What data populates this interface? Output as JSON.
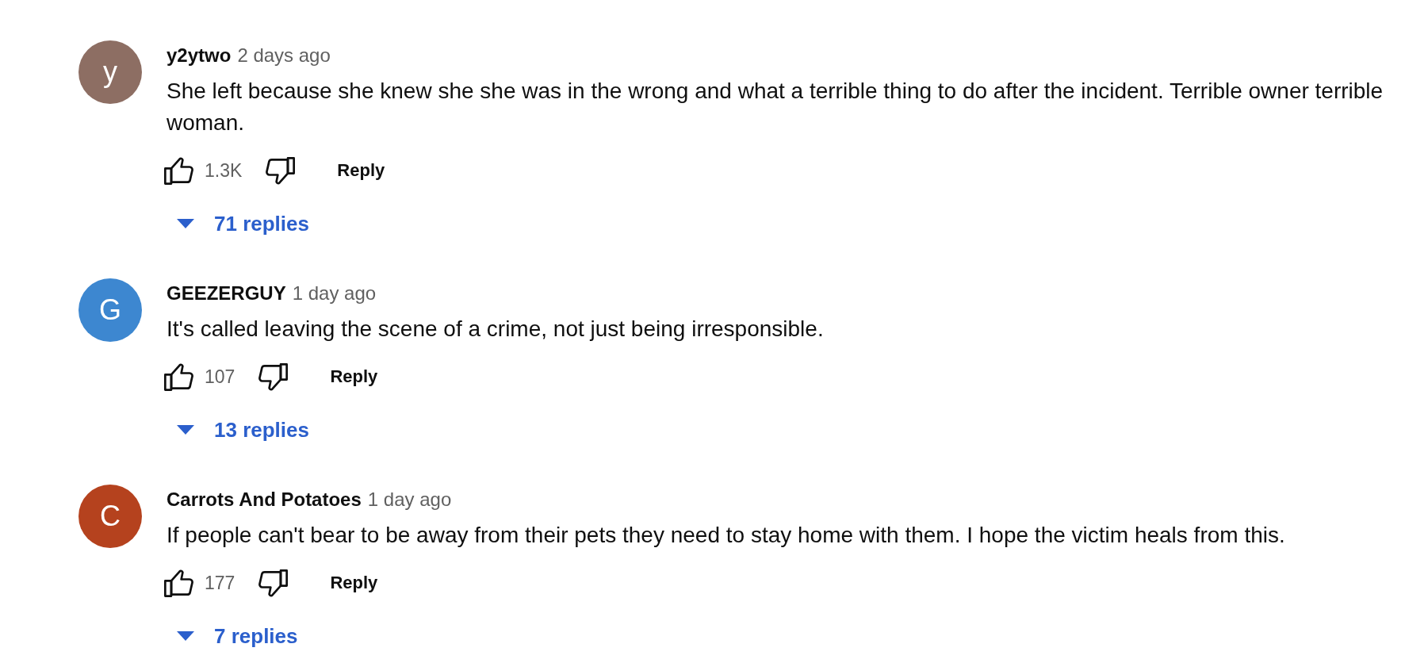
{
  "comments": [
    {
      "avatar_letter": "y",
      "color": "#8d6e63",
      "author": "y2ytwo",
      "time": "2 days ago",
      "text": "She left because she knew she she was in the wrong and what a terrible thing to do after the incident. Terrible owner terrible woman.",
      "likes": "1.3K",
      "reply": "Reply",
      "replies": "71 replies",
      "expanded": false
    },
    {
      "avatar_letter": "G",
      "color": "#3d87d0",
      "author": "GEEZERGUY",
      "time": "1 day ago",
      "text": "It's called leaving the scene of a crime, not just being irresponsible.",
      "likes": "107",
      "reply": "Reply",
      "replies": "13 replies",
      "expanded": false
    },
    {
      "avatar_letter": "C",
      "color": "#b5421e",
      "author": "Carrots And Potatoes",
      "time": "1 day ago",
      "text": "If people can't bear to be away from their pets they need to stay home with them. I hope the victim heals from this.",
      "likes": "177",
      "reply": "Reply",
      "replies": "7 replies",
      "expanded": false
    }
  ]
}
